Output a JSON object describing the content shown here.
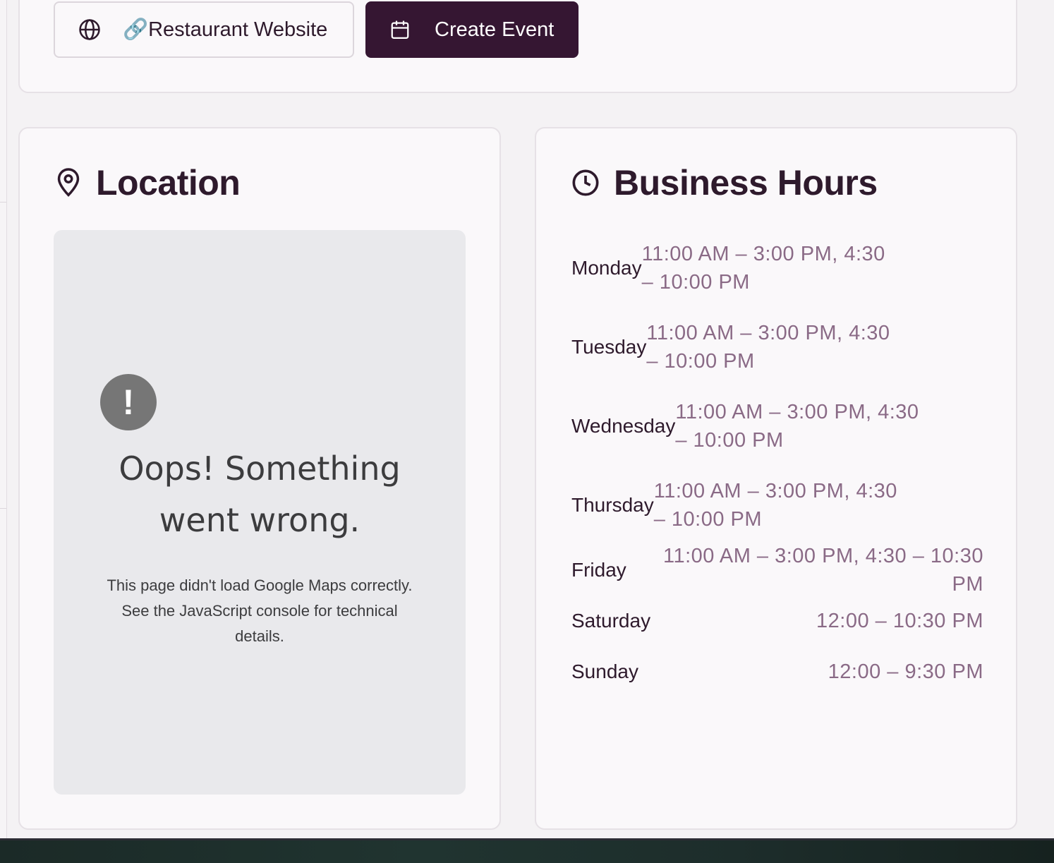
{
  "actions": {
    "website_label": "🔗Restaurant Website",
    "create_event_label": "Create Event"
  },
  "location": {
    "title": "Location",
    "map_error": {
      "icon_glyph": "!",
      "title": "Oops! Something went wrong.",
      "body": "This page didn't load Google Maps correctly. See the JavaScript console for technical details."
    }
  },
  "hours": {
    "title": "Business Hours",
    "days": [
      {
        "day": "Monday",
        "time": "11:00 AM – 3:00 PM, 4:30 – 10:00 PM"
      },
      {
        "day": "Tuesday",
        "time": "11:00 AM – 3:00 PM, 4:30 – 10:00 PM"
      },
      {
        "day": "Wednesday",
        "time": "11:00 AM – 3:00 PM, 4:30 – 10:00 PM"
      },
      {
        "day": "Thursday",
        "time": "11:00 AM – 3:00 PM, 4:30 – 10:00 PM"
      },
      {
        "day": "Friday",
        "time": "11:00 AM – 3:00 PM, 4:30 – 10:30 PM"
      },
      {
        "day": "Saturday",
        "time": "12:00 – 10:30 PM"
      },
      {
        "day": "Sunday",
        "time": "12:00 – 9:30 PM"
      }
    ]
  },
  "colors": {
    "primary": "#351632",
    "muted_time": "#8a6a86",
    "card_bg": "#faf8fa",
    "map_bg": "#e9e9ec"
  },
  "icons": {
    "website": "globe-icon",
    "event": "calendar-icon",
    "location": "map-pin-icon",
    "hours": "clock-icon",
    "map_error": "exclamation-icon"
  }
}
